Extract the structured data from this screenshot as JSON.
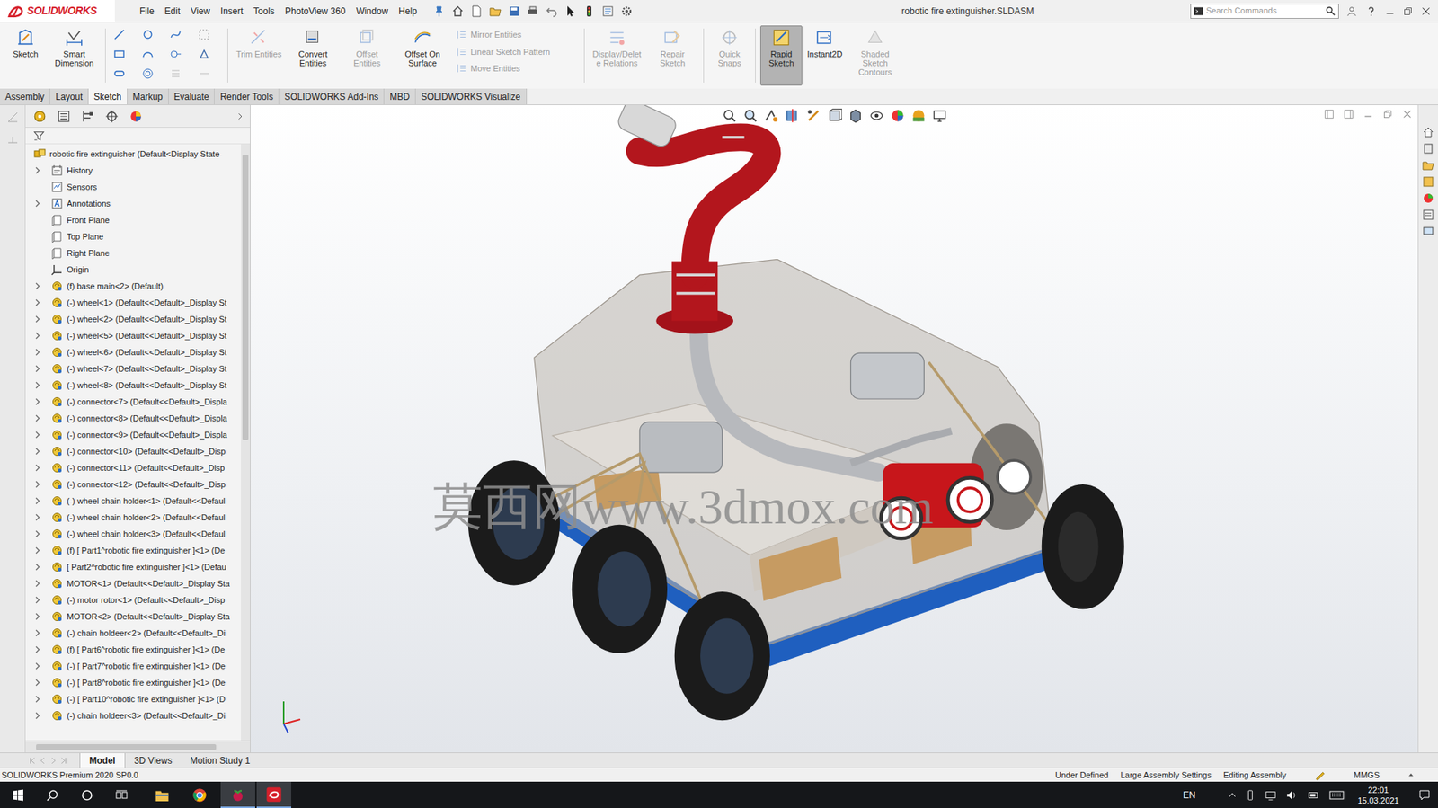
{
  "window": {
    "title": "robotic fire extinguisher.SLDASM",
    "logo": "SOLIDWORKS"
  },
  "menu": [
    "File",
    "Edit",
    "View",
    "Insert",
    "Tools",
    "PhotoView 360",
    "Window",
    "Help"
  ],
  "search": {
    "placeholder": "Search Commands"
  },
  "ribbon": {
    "groups": [
      {
        "items": [
          {
            "label": "Sketch",
            "kind": "large",
            "disabled": false,
            "selected": false
          },
          {
            "label": "Smart Dimension",
            "kind": "large",
            "disabled": false,
            "selected": false
          }
        ]
      },
      {
        "items": [
          {
            "label": "Trim Entities",
            "kind": "large",
            "disabled": true,
            "selected": false
          },
          {
            "label": "Convert Entities",
            "kind": "large",
            "disabled": false,
            "selected": false
          },
          {
            "label": "Offset Entities",
            "kind": "large",
            "disabled": true,
            "selected": false
          },
          {
            "label": "Offset On Surface",
            "kind": "large",
            "disabled": false,
            "selected": false
          },
          {
            "label": "Mirror Entities",
            "kind": "small",
            "disabled": true,
            "selected": false
          },
          {
            "label": "Linear Sketch Pattern",
            "kind": "small",
            "disabled": true,
            "selected": false
          },
          {
            "label": "Move Entities",
            "kind": "small",
            "disabled": true,
            "selected": false
          }
        ]
      },
      {
        "items": [
          {
            "label": "Display/Delete Relations",
            "kind": "large",
            "disabled": true,
            "selected": false
          },
          {
            "label": "Repair Sketch",
            "kind": "large",
            "disabled": true,
            "selected": false
          }
        ]
      },
      {
        "items": [
          {
            "label": "Quick Snaps",
            "kind": "large",
            "disabled": true,
            "selected": false
          }
        ]
      },
      {
        "items": [
          {
            "label": "Rapid Sketch",
            "kind": "large",
            "disabled": false,
            "selected": true
          },
          {
            "label": "Instant2D",
            "kind": "large",
            "disabled": false,
            "selected": false
          },
          {
            "label": "Shaded Sketch Contours",
            "kind": "large",
            "disabled": true,
            "selected": false
          }
        ]
      }
    ]
  },
  "ribbon_tabs": [
    {
      "label": "Assembly",
      "selected": false
    },
    {
      "label": "Layout",
      "selected": false
    },
    {
      "label": "Sketch",
      "selected": true
    },
    {
      "label": "Markup",
      "selected": false
    },
    {
      "label": "Evaluate",
      "selected": false
    },
    {
      "label": "Render Tools",
      "selected": false
    },
    {
      "label": "SOLIDWORKS Add-Ins",
      "selected": false
    },
    {
      "label": "MBD",
      "selected": false
    },
    {
      "label": "SOLIDWORKS Visualize",
      "selected": false
    }
  ],
  "feature_tree": {
    "items": [
      {
        "label": "robotic fire extinguisher  (Default<Display State-",
        "kind": "root",
        "expandable": false
      },
      {
        "label": "History",
        "kind": "history",
        "expandable": true
      },
      {
        "label": "Sensors",
        "kind": "sensor",
        "expandable": false
      },
      {
        "label": "Annotations",
        "kind": "annotation",
        "expandable": true
      },
      {
        "label": "Front Plane",
        "kind": "plane",
        "expandable": false
      },
      {
        "label": "Top Plane",
        "kind": "plane",
        "expandable": false
      },
      {
        "label": "Right Plane",
        "kind": "plane",
        "expandable": false
      },
      {
        "label": "Origin",
        "kind": "origin",
        "expandable": false
      },
      {
        "label": "(f) base main<2> (Default)",
        "kind": "component",
        "expandable": true
      },
      {
        "label": "(-) wheel<1> (Default<<Default>_Display St",
        "kind": "component",
        "expandable": true
      },
      {
        "label": "(-) wheel<2> (Default<<Default>_Display St",
        "kind": "component",
        "expandable": true
      },
      {
        "label": "(-) wheel<5> (Default<<Default>_Display St",
        "kind": "component",
        "expandable": true
      },
      {
        "label": "(-) wheel<6> (Default<<Default>_Display St",
        "kind": "component",
        "expandable": true
      },
      {
        "label": "(-) wheel<7> (Default<<Default>_Display St",
        "kind": "component",
        "expandable": true
      },
      {
        "label": "(-) wheel<8> (Default<<Default>_Display St",
        "kind": "component",
        "expandable": true
      },
      {
        "label": "(-) connector<7> (Default<<Default>_Displa",
        "kind": "component",
        "expandable": true
      },
      {
        "label": "(-) connector<8> (Default<<Default>_Displa",
        "kind": "component",
        "expandable": true
      },
      {
        "label": "(-) connector<9> (Default<<Default>_Displa",
        "kind": "component",
        "expandable": true
      },
      {
        "label": "(-) connector<10> (Default<<Default>_Disp",
        "kind": "component",
        "expandable": true
      },
      {
        "label": "(-) connector<11> (Default<<Default>_Disp",
        "kind": "component",
        "expandable": true
      },
      {
        "label": "(-) connector<12> (Default<<Default>_Disp",
        "kind": "component",
        "expandable": true
      },
      {
        "label": "(-) wheel chain holder<1> (Default<<Defaul",
        "kind": "component",
        "expandable": true
      },
      {
        "label": "(-) wheel chain holder<2> (Default<<Defaul",
        "kind": "component",
        "expandable": true
      },
      {
        "label": "(-) wheel chain holder<3> (Default<<Defaul",
        "kind": "component",
        "expandable": true
      },
      {
        "label": "(f) [ Part1^robotic fire extinguisher ]<1> (De",
        "kind": "component",
        "expandable": true
      },
      {
        "label": "[ Part2^robotic fire extinguisher ]<1> (Defau",
        "kind": "component",
        "expandable": true
      },
      {
        "label": "MOTOR<1> (Default<<Default>_Display Sta",
        "kind": "component",
        "expandable": true
      },
      {
        "label": "(-) motor rotor<1> (Default<<Default>_Disp",
        "kind": "component",
        "expandable": true
      },
      {
        "label": "MOTOR<2> (Default<<Default>_Display Sta",
        "kind": "component",
        "expandable": true
      },
      {
        "label": "(-) chain holdeer<2> (Default<<Default>_Di",
        "kind": "component",
        "expandable": true
      },
      {
        "label": "(f) [ Part6^robotic fire extinguisher ]<1> (De",
        "kind": "component",
        "expandable": true
      },
      {
        "label": "(-) [ Part7^robotic fire extinguisher ]<1> (De",
        "kind": "component",
        "expandable": true
      },
      {
        "label": "(-) [ Part8^robotic fire extinguisher ]<1> (De",
        "kind": "component",
        "expandable": true
      },
      {
        "label": "(-) [ Part10^robotic fire extinguisher ]<1> (D",
        "kind": "component",
        "expandable": true
      },
      {
        "label": "(-) chain holdeer<3> (Default<<Default>_Di",
        "kind": "component",
        "expandable": true
      }
    ]
  },
  "viewport": {
    "watermark": "莫西网www.3dmox.com"
  },
  "bottom_tabs": [
    {
      "label": "Model",
      "selected": true
    },
    {
      "label": "3D Views",
      "selected": false
    },
    {
      "label": "Motion Study 1",
      "selected": false
    }
  ],
  "status_bar": {
    "product": "SOLIDWORKS Premium 2020 SP0.0",
    "items": [
      "Under Defined",
      "Large Assembly Settings",
      "Editing Assembly",
      "MMGS"
    ]
  },
  "taskbar": {
    "language": "EN",
    "time": "22:01",
    "date": "15.03.2021"
  }
}
